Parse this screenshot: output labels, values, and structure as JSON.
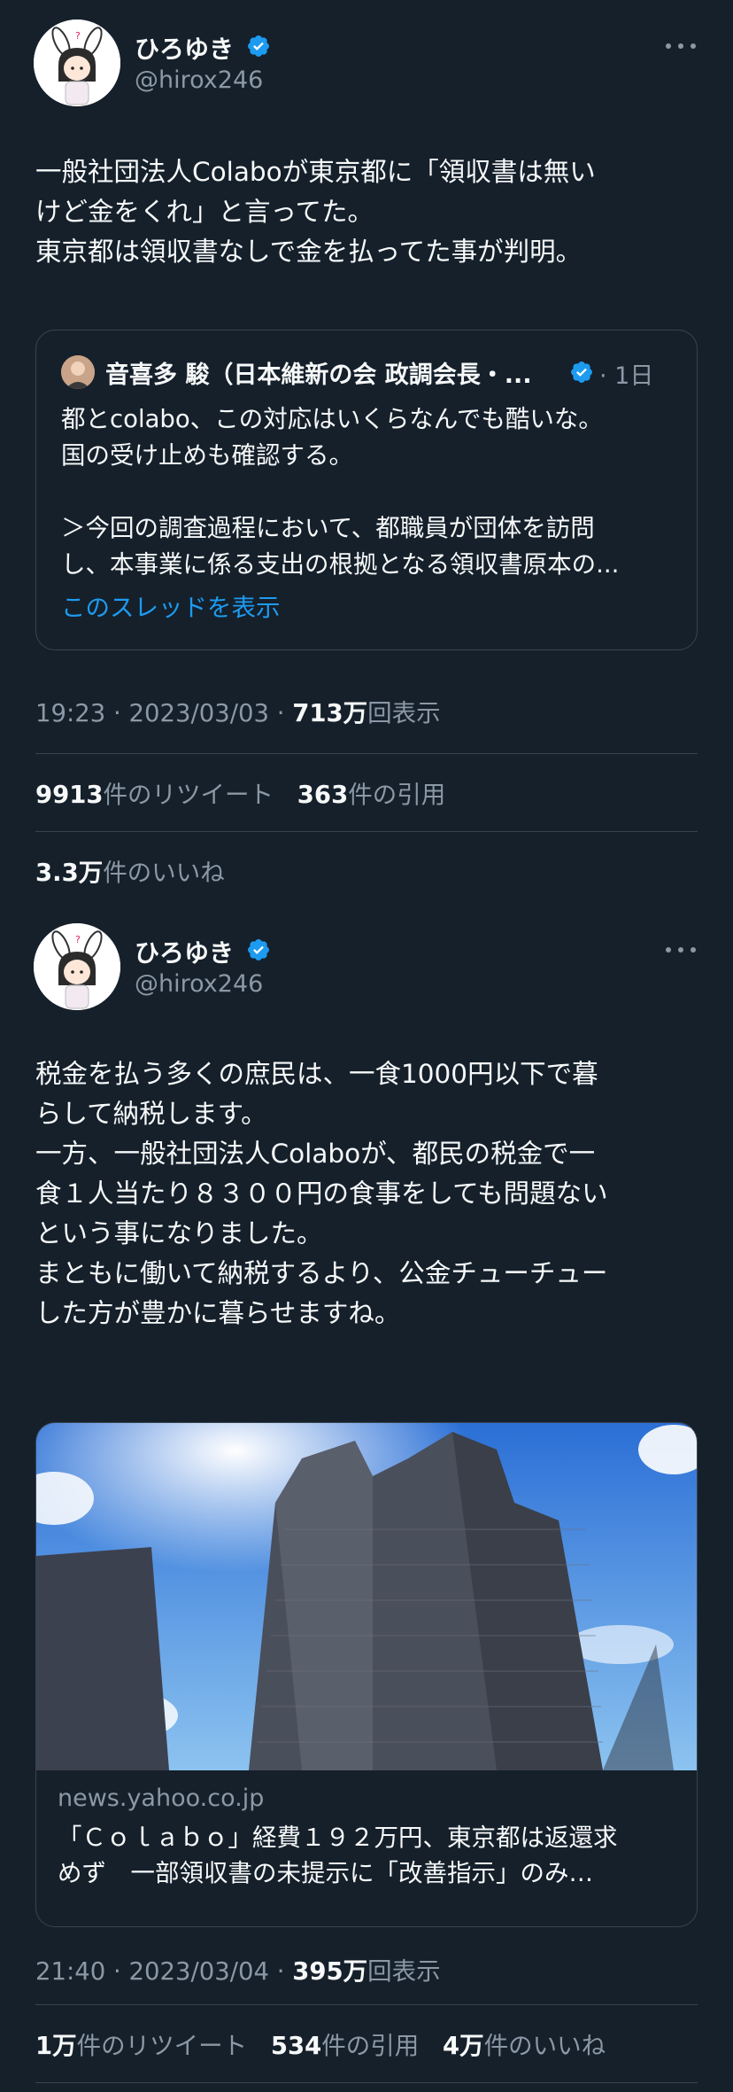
{
  "tweets": [
    {
      "author": {
        "name": "ひろゆき",
        "handle": "@hirox246",
        "verified": true
      },
      "body": "一般社団法人Colaboが東京都に「領収書は無い\nけど金をくれ」と言ってた。\n東京都は領収書なしで金を払ってた事が判明。",
      "quote": {
        "author": "音喜多 駿（日本維新の会 政調会長・...",
        "time": "1日",
        "text": "都とcolabo、この対応はいくらなんでも酷いな。\n国の受け止めも確認する。\n\n＞今回の調査過程において、都職員が団体を訪問\nし、本事業に係る支出の根拠となる領収書原本の...",
        "show_thread": "このスレッドを表示"
      },
      "meta": {
        "time": "19:23 · 2023/03/03 · ",
        "views": "713万",
        "views_label": "回表示"
      },
      "stats": {
        "retweets": "9913",
        "retweets_label": "件のリツイート",
        "quotes": "363",
        "quotes_label": "件の引用",
        "likes": "3.3万",
        "likes_label": "件のいいね"
      }
    },
    {
      "author": {
        "name": "ひろゆき",
        "handle": "@hirox246",
        "verified": true
      },
      "body": "税金を払う多くの庶民は、一食1000円以下で暮\nらして納税します。\n一方、一般社団法人Colaboが、都民の税金で一\n食１人当たり８３００円の食事をしても問題ない\nという事になりました。\nまともに働いて納税するより、公金チューチュー\nした方が豊かに暮らせますね。",
      "card": {
        "domain": "news.yahoo.co.jp",
        "title": "「Ｃｏｌａｂｏ」経費１９２万円、東京都は返還求\nめず　一部領収書の未提示に「改善指示」のみ…",
        "image": "tokyo-metropolitan-government-building-photo"
      },
      "meta": {
        "time": "21:40 · 2023/03/04 · ",
        "views": "395万",
        "views_label": "回表示"
      },
      "stats": {
        "retweets": "1万",
        "retweets_label": "件のリツイート",
        "quotes": "534",
        "quotes_label": "件の引用",
        "likes": "4万",
        "likes_label": "件のいいね"
      }
    }
  ],
  "colors": {
    "background": "#15202b",
    "text": "#f7f9f9",
    "secondary": "#8b98a5",
    "link": "#1d9bf0",
    "border": "#38444d",
    "verified": "#1d9bf0"
  },
  "icons": {
    "verified": "verified-badge-icon",
    "more": "more-horizontal-icon"
  }
}
